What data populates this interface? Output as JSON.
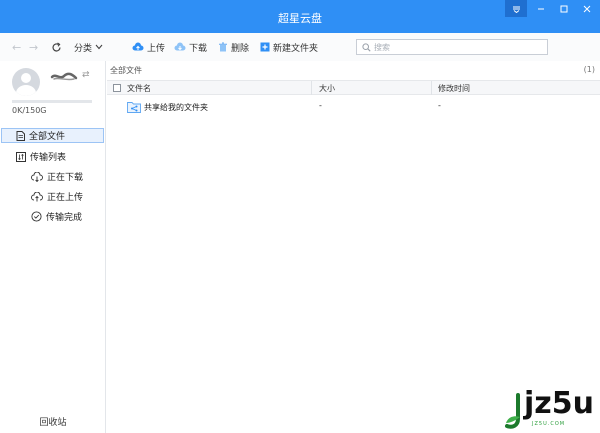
{
  "window": {
    "title": "超星云盘",
    "controls": [
      "menu-icon",
      "minimize-icon",
      "maximize-icon",
      "close-icon"
    ]
  },
  "toolbar": {
    "category_label": "分类",
    "upload_label": "上传",
    "download_label": "下载",
    "delete_label": "删除",
    "new_folder_label": "新建文件夹",
    "search_placeholder": "搜索"
  },
  "user": {
    "quota": "0K/150G",
    "quota_used_fraction": 0
  },
  "sidebar": {
    "items": [
      {
        "label": "全部文件",
        "icon": "document-icon",
        "active": true
      },
      {
        "label": "传输列表",
        "icon": "transfer-icon",
        "active": false
      },
      {
        "label": "正在下载",
        "icon": "cloud-download-icon",
        "active": false
      },
      {
        "label": "正在上传",
        "icon": "cloud-upload-icon",
        "active": false
      },
      {
        "label": "传输完成",
        "icon": "check-circle-icon",
        "active": false
      }
    ],
    "recycle_label": "回收站"
  },
  "main": {
    "breadcrumb": "全部文件",
    "count": "(1)",
    "columns": [
      "文件名",
      "大小",
      "修改时间"
    ],
    "rows": [
      {
        "name": "共享给我的文件夹",
        "size": "-",
        "modified": "-",
        "icon": "shared-folder-icon"
      }
    ]
  },
  "watermark": {
    "text": "jz5u",
    "sub": "JZ5U.COM"
  },
  "colors": {
    "accent": "#2f8ff5",
    "active_item_bg": "#e8f1fd",
    "active_item_border": "#9cc4f5"
  }
}
